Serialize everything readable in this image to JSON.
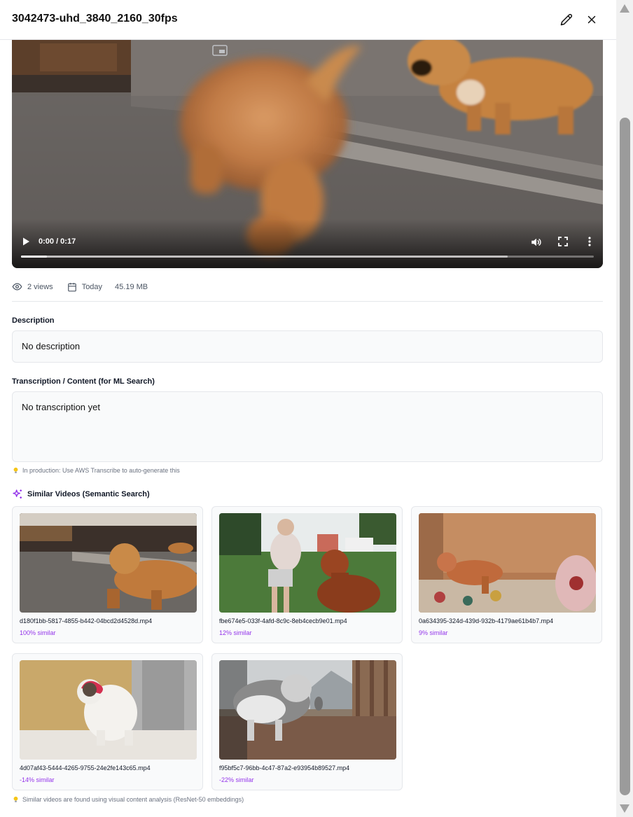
{
  "header": {
    "title": "3042473-uhd_3840_2160_30fps"
  },
  "player": {
    "time": "0:00 / 0:17",
    "played": 0.045,
    "buffered": 0.85
  },
  "meta": {
    "views": "2 views",
    "date": "Today",
    "size": "45.19 MB"
  },
  "description": {
    "label": "Description",
    "value": "No description"
  },
  "transcription": {
    "label": "Transcription / Content (for ML Search)",
    "value": "No transcription yet",
    "hint": "In production: Use AWS Transcribe to auto-generate this"
  },
  "similar": {
    "title": "Similar Videos (Semantic Search)",
    "accent": "#9333ea",
    "items": [
      {
        "file": "d180f1bb-5817-4855-b442-04bcd2d4528d.mp4",
        "score": "100% similar"
      },
      {
        "file": "fbe674e5-033f-4afd-8c9c-8eb4cecb9e01.mp4",
        "score": "12% similar"
      },
      {
        "file": "0a634395-324d-439d-932b-4179ae61b4b7.mp4",
        "score": "9% similar"
      },
      {
        "file": "4d07af43-5444-4265-9755-24e2fe143c65.mp4",
        "score": "-14% similar"
      },
      {
        "file": "f95bf5c7-96bb-4c47-87a2-e93954b89527.mp4",
        "score": "-22% similar"
      }
    ],
    "footer": "Similar videos are found using visual content analysis (ResNet-50 embeddings)"
  }
}
